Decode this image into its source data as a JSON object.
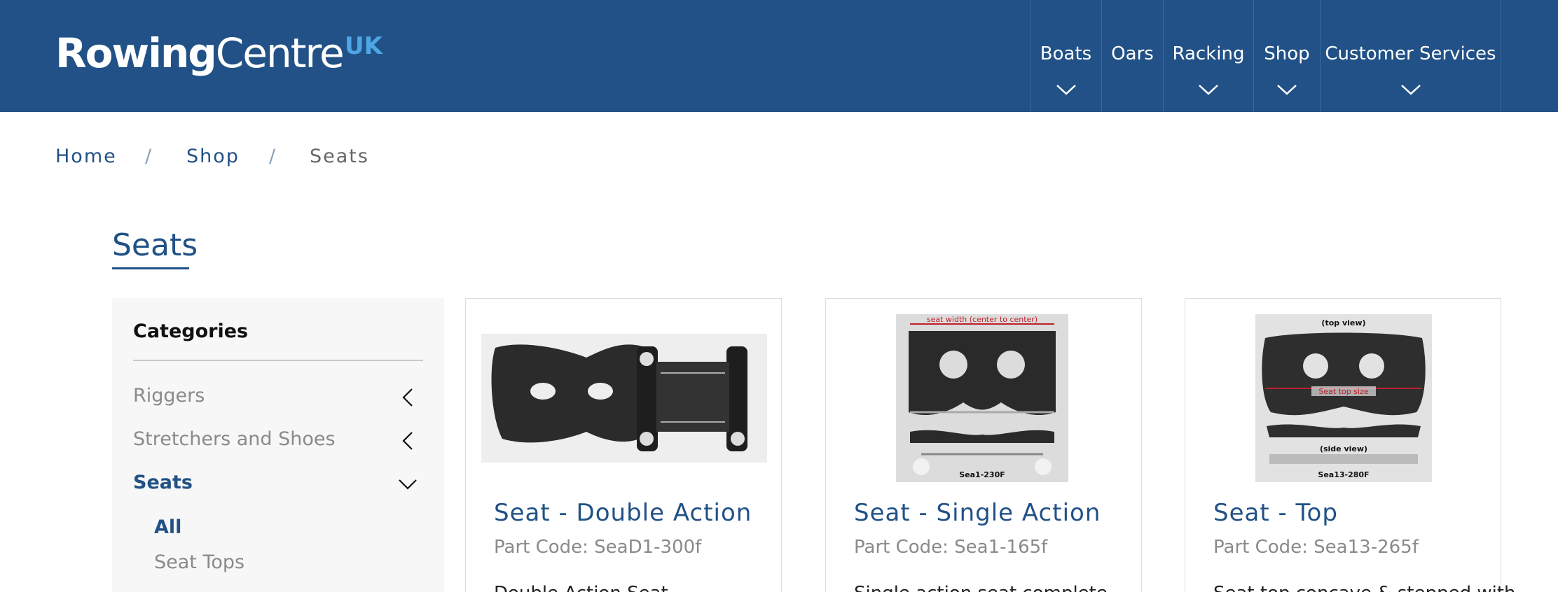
{
  "header": {
    "logo": {
      "bold": "Rowing",
      "light": "Centre",
      "suffix": "UK"
    },
    "nav": [
      {
        "label": "Boats",
        "has_dropdown": true
      },
      {
        "label": "Oars",
        "has_dropdown": false
      },
      {
        "label": "Racking",
        "has_dropdown": true
      },
      {
        "label": "Shop",
        "has_dropdown": true
      },
      {
        "label": "Customer Services",
        "has_dropdown": true
      }
    ]
  },
  "breadcrumb": {
    "items": [
      "Home",
      "Shop",
      "Seats"
    ],
    "separator": "/"
  },
  "page": {
    "title": "Seats"
  },
  "sidebar": {
    "heading": "Categories",
    "categories": [
      {
        "label": "Riggers",
        "icon": "chevron-left-icon"
      },
      {
        "label": "Stretchers and Shoes",
        "icon": "chevron-left-icon"
      },
      {
        "label": "Seats",
        "icon": "chevron-down-icon",
        "active": true
      }
    ],
    "subcategories": [
      {
        "label": "All",
        "active": true
      },
      {
        "label": "Seat Tops"
      }
    ]
  },
  "products": [
    {
      "title": "Seat - Double Action",
      "part_code": "Part Code: SeaD1-300f",
      "description": "Double Action Seat",
      "image": "double-action-seat-photo"
    },
    {
      "title": "Seat - Single Action",
      "part_code": "Part Code: Sea1-165f",
      "description": "Single action seat complete",
      "image": "single-action-seat-photo",
      "image_labels": {
        "top": "seat width (center to center)",
        "bottom": "Sea1-230F"
      }
    },
    {
      "title": "Seat - Top",
      "part_code": "Part Code: Sea13-265f",
      "description": "Seat top concave & stepped with",
      "image": "seat-top-photo",
      "image_labels": {
        "top": "(top view)",
        "middle": "Seat top size",
        "side": "(side view)",
        "bottom": "Sea13-280F"
      }
    }
  ],
  "colors": {
    "brand": "#215186",
    "accent": "#4ea7e4",
    "muted_text": "#8a8a8a",
    "sidebar_bg": "#f7f7f7"
  }
}
